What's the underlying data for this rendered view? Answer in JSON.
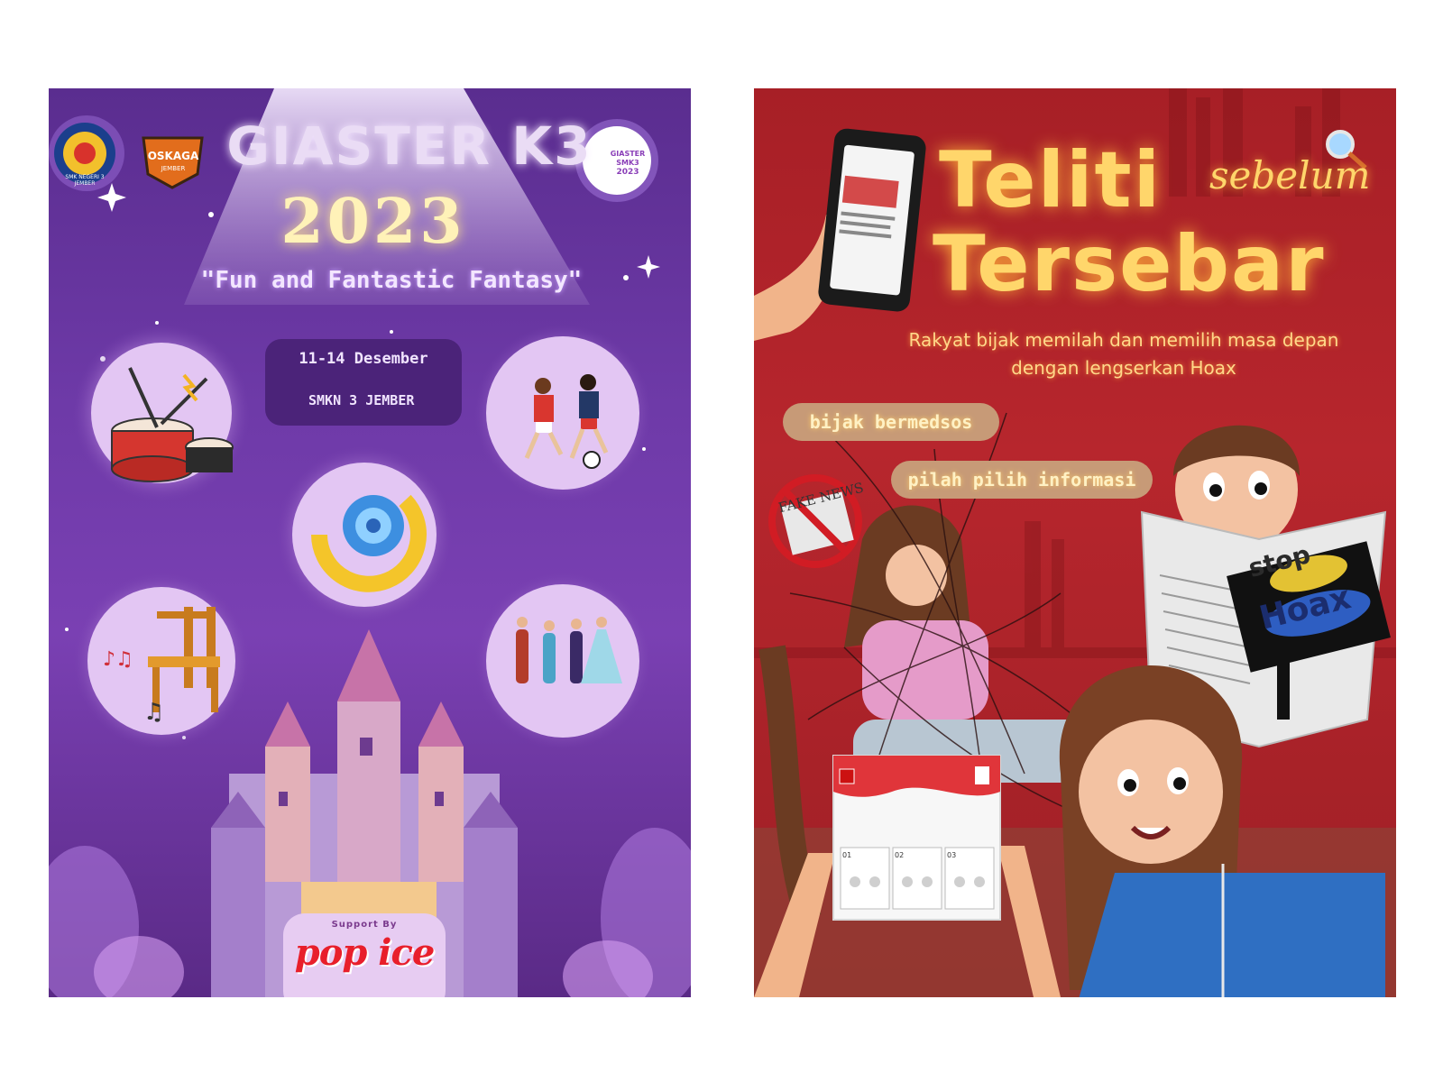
{
  "left_poster": {
    "logo1_label": "SMK NEGERI 3 JEMBER",
    "logo2_label": "OSKAGA",
    "logo2_sub": "JEMBER",
    "logo3_line1": "GIASTER",
    "logo3_line2": "SMK3",
    "logo3_line3": "2023",
    "title": "GIASTER K3",
    "year": "2023",
    "tagline": "\"Fun and Fantastic Fantasy\"",
    "date": "11-14 Desember",
    "location": "SMKN 3 JEMBER",
    "support_label": "Support By",
    "sponsor": "pop ice",
    "icons": [
      "drum-icon",
      "football-icon",
      "swirl-icon",
      "music-chair-icon",
      "costume-characters-icon",
      "castle-icon"
    ]
  },
  "right_poster": {
    "title_line1": "Teliti",
    "title_script": "sebelum",
    "title_line2": "Tersebar",
    "tagline_line1": "Rakyat bijak memilah dan memilih masa depan",
    "tagline_line2": "dengan lengserkan Hoax",
    "pill1": "bijak bermedsos",
    "pill2": "pilah pilih informasi",
    "fake_news_label": "FAKE NEWS",
    "sign_line1": "stop",
    "sign_line2": "Hoax",
    "ballot_numbers": [
      "01",
      "02",
      "03"
    ],
    "icons": [
      "phone-icon",
      "magnifier-icon",
      "newspaper-icon",
      "ballot-icon"
    ]
  },
  "colors": {
    "left_bg": "#6e3aa8",
    "right_bg": "#b7262d",
    "gold_text": "#ffd66b"
  }
}
